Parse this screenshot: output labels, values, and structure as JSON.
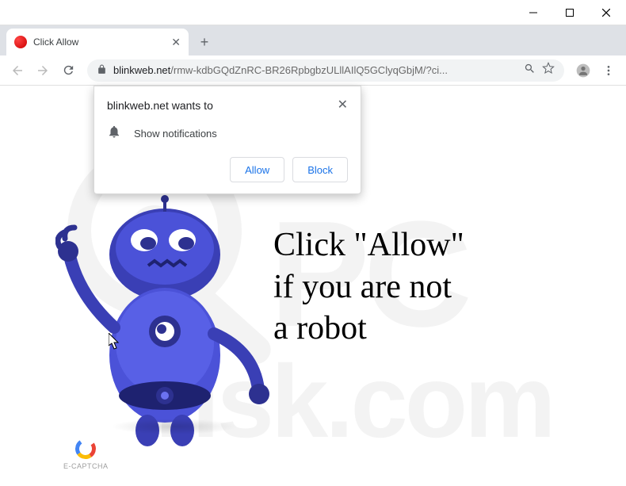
{
  "window": {
    "tab_title": "Click Allow",
    "url_host": "blinkweb.net",
    "url_path": "/rmw-kdbGQdZnRC-BR26RpbgbzULllAIlQ5GClyqGbjM/?ci..."
  },
  "permission": {
    "origin": "blinkweb.net wants to",
    "label": "Show notifications",
    "allow": "Allow",
    "block": "Block"
  },
  "page": {
    "message": "Click \"Allow\"\nif you are not\na robot",
    "captcha": "E-CAPTCHA"
  }
}
